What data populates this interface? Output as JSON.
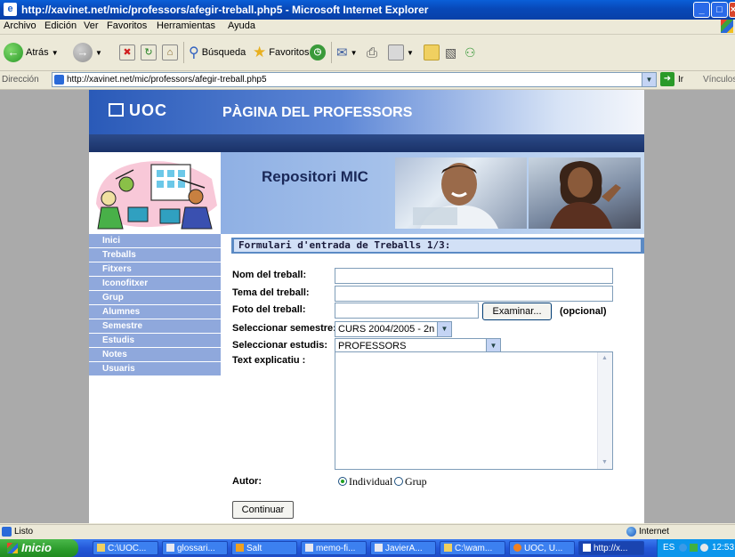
{
  "window": {
    "title": "http://xavinet.net/mic/professors/afegir-treball.php5 - Microsoft Internet Explorer",
    "buttons": {
      "minimize": "_",
      "maximize": "□",
      "close": "×"
    }
  },
  "menu": {
    "items": [
      "Archivo",
      "Edición",
      "Ver",
      "Favoritos",
      "Herramientas",
      "Ayuda"
    ]
  },
  "toolbar": {
    "back_label": "Atrás",
    "search_label": "Búsqueda",
    "favorites_label": "Favoritos"
  },
  "address": {
    "label": "Dirección",
    "url": "http://xavinet.net/mic/professors/afegir-treball.php5",
    "go_label": "Ir",
    "links_label": "Vínculos"
  },
  "page": {
    "logo": "UOC",
    "header_title": "PÀGINA DEL PROFESSORS",
    "banner_title": "Repositori MIC",
    "nav": [
      "Inici",
      "Treballs",
      "Fitxers",
      "Iconofitxer",
      "Grup",
      "Alumnes",
      "Semestre",
      "Estudis",
      "Notes",
      "Usuaris"
    ],
    "form": {
      "title": "Formulari d'entrada de Treballs 1/3:",
      "nom_label": "Nom del treball:",
      "nom_value": "",
      "tema_label": "Tema del treball:",
      "tema_value": "",
      "foto_label": "Foto del treball:",
      "foto_value": "",
      "browse_label": "Examinar...",
      "optional_label": "(opcional)",
      "semestre_label": "Seleccionar semestre:",
      "semestre_value": "CURS 2004/2005 - 2n",
      "estudis_label": "Seleccionar estudis:",
      "estudis_value": "PROFESSORS",
      "text_label": "Text explicatiu :",
      "text_value": "",
      "autor_label": "Autor:",
      "radio_individual": "Individual",
      "radio_grup": "Grup",
      "autor_selected": "Individual",
      "submit_label": "Continuar"
    }
  },
  "status": {
    "text": "Listo",
    "zone": "Internet"
  },
  "taskbar": {
    "start_label": "Inicio",
    "tasks": [
      "C:\\UOC...",
      "glossari...",
      "Salt",
      "memo-fi...",
      "JavierA...",
      "C:\\wam...",
      "UOC, U...",
      "http://x..."
    ],
    "lang": "ES",
    "clock": "12:53"
  },
  "colors": {
    "title_bar": "#0a5fd8",
    "nav_item": "#8fa8dc",
    "form_header": "#5b8ac4",
    "taskbar": "#2458d8",
    "start_button": "#2a9a2a"
  }
}
